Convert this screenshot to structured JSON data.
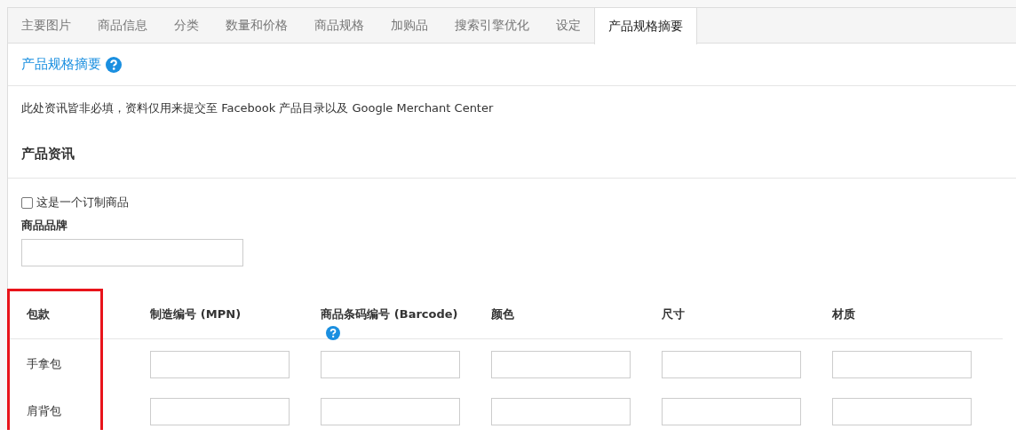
{
  "tabs": [
    {
      "label": "主要图片",
      "selected": false
    },
    {
      "label": "商品信息",
      "selected": false
    },
    {
      "label": "分类",
      "selected": false
    },
    {
      "label": "数量和价格",
      "selected": false
    },
    {
      "label": "商品规格",
      "selected": false
    },
    {
      "label": "加购品",
      "selected": false
    },
    {
      "label": "搜索引擎优化",
      "selected": false
    },
    {
      "label": "设定",
      "selected": false
    },
    {
      "label": "产品规格摘要",
      "selected": true
    }
  ],
  "panel": {
    "title": "产品规格摘要",
    "notice": "此处资讯皆非必填，资料仅用来提交至 Facebook 产品目录以及 Google Merchant Center",
    "section": "产品资讯",
    "custom_checkbox": {
      "label": "这是一个订制商品",
      "checked": false
    },
    "brand": {
      "label": "商品品牌"
    }
  },
  "table": {
    "columns": [
      {
        "label": "包款",
        "help": false
      },
      {
        "label": "制造编号 (MPN)",
        "help": false
      },
      {
        "label": "商品条码编号 (Barcode)",
        "help": true
      },
      {
        "label": "颜色",
        "help": false
      },
      {
        "label": "尺寸",
        "help": false
      },
      {
        "label": "材质",
        "help": false
      }
    ],
    "rows": [
      {
        "name": "手拿包"
      },
      {
        "name": "肩背包"
      }
    ]
  }
}
